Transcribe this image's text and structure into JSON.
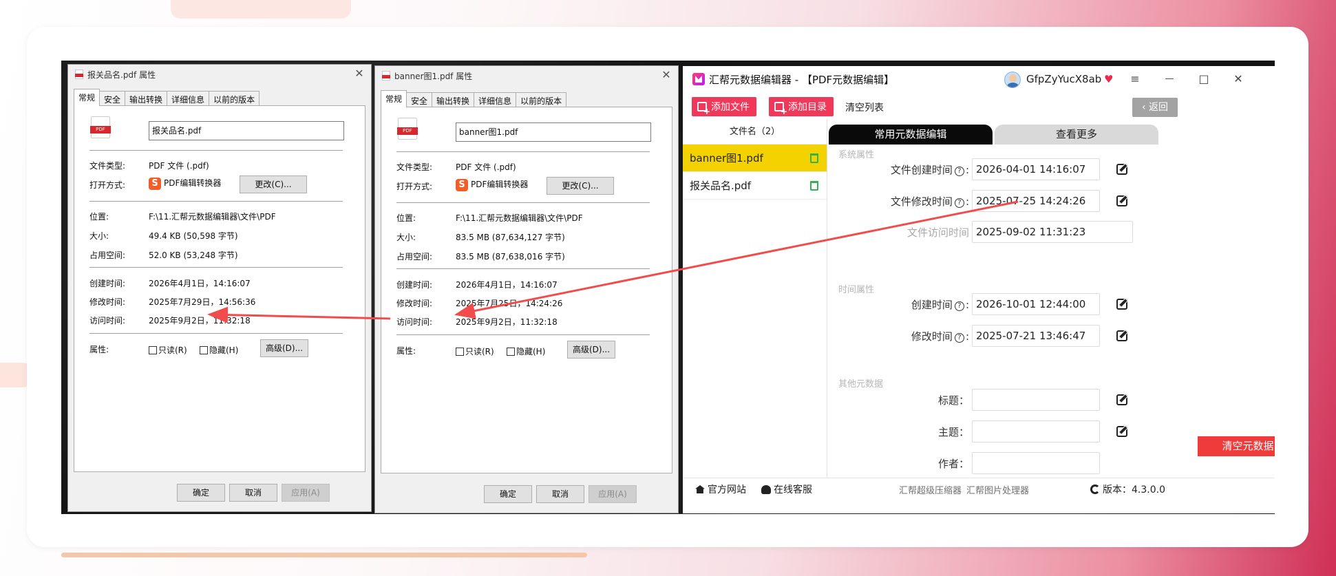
{
  "dialog_left": {
    "title": "报关品名.pdf 属性",
    "tabs": [
      "常规",
      "安全",
      "输出转换",
      "详细信息",
      "以前的版本"
    ],
    "filename": "报关品名.pdf",
    "rows": {
      "type_label": "文件类型:",
      "type_value": "PDF 文件 (.pdf)",
      "open_label": "打开方式:",
      "open_value": "PDF编辑转换器",
      "change_btn": "更改(C)...",
      "loc_label": "位置:",
      "loc_value": "F:\\11.汇帮元数据编辑器\\文件\\PDF",
      "size_label": "大小:",
      "size_value": "49.4 KB (50,598 字节)",
      "disk_label": "占用空间:",
      "disk_value": "52.0 KB (53,248 字节)",
      "created_label": "创建时间:",
      "created_value": "2026年4月1日，14:16:07",
      "modified_label": "修改时间:",
      "modified_value": "2025年7月29日，14:56:36",
      "accessed_label": "访问时间:",
      "accessed_value": "2025年9月2日，11:32:18",
      "attr_label": "属性:",
      "readonly": "只读(R)",
      "hidden": "隐藏(H)",
      "advanced_btn": "高级(D)..."
    },
    "ok": "确定",
    "cancel": "取消",
    "apply": "应用(A)"
  },
  "dialog_mid": {
    "title": "banner图1.pdf 属性",
    "tabs": [
      "常规",
      "安全",
      "输出转换",
      "详细信息",
      "以前的版本"
    ],
    "filename": "banner图1.pdf",
    "rows": {
      "type_label": "文件类型:",
      "type_value": "PDF 文件 (.pdf)",
      "open_label": "打开方式:",
      "open_value": "PDF编辑转换器",
      "change_btn": "更改(C)...",
      "loc_label": "位置:",
      "loc_value": "F:\\11.汇帮元数据编辑器\\文件\\PDF",
      "size_label": "大小:",
      "size_value": "83.5 MB (87,634,127 字节)",
      "disk_label": "占用空间:",
      "disk_value": "83.5 MB (87,638,016 字节)",
      "created_label": "创建时间:",
      "created_value": "2026年4月1日，14:16:07",
      "modified_label": "修改时间:",
      "modified_value": "2025年7月25日，14:24:26",
      "accessed_label": "访问时间:",
      "accessed_value": "2025年9月2日，11:32:18",
      "attr_label": "属性:",
      "readonly": "只读(R)",
      "hidden": "隐藏(H)",
      "advanced_btn": "高级(D)..."
    },
    "ok": "确定",
    "cancel": "取消",
    "apply": "应用(A)"
  },
  "app": {
    "title": "汇帮元数据编辑器 - 【PDF元数据编辑】",
    "user": "GfpZyYucX8ab",
    "win": {
      "menu": "≡",
      "min": "—",
      "max": "□",
      "close": "✕"
    },
    "toolbar": {
      "add_file": "添加文件",
      "add_dir": "添加目录",
      "clear_list": "清空列表",
      "back": "返回"
    },
    "sidebar": {
      "header": "文件名（2）",
      "files": [
        "banner图1.pdf",
        "报关品名.pdf"
      ]
    },
    "tabs": {
      "common": "常用元数据编辑",
      "more": "查看更多"
    },
    "system_section": "系统属性",
    "file_created_label": "文件创建时间",
    "file_created": "2026-04-01 14:16:07",
    "file_modified_label": "文件修改时间",
    "file_modified": "2025-07-25 14:24:26",
    "file_accessed_label": "文件访问时间",
    "file_accessed": "2025-09-02 11:31:23",
    "time_section": "时间属性",
    "created_label": "创建时间",
    "created": "2026-10-01 12:44:00",
    "modified_label": "修改时间",
    "modified": "2025-07-21 13:46:47",
    "other_section": "其他元数据",
    "title_label": "标题：",
    "subject_label": "主题：",
    "author_label": "作者：",
    "clear_meta": "清空元数据",
    "footer": {
      "website": "官方网站",
      "service": "在线客服",
      "compressor": "汇帮超级压缩器",
      "image_tool": "汇帮图片处理器",
      "version": "版本：4.3.0.0"
    }
  },
  "colors": {
    "accent_red": "#f0385b",
    "selected_yellow": "#f3d200",
    "arrow": "#f24b4b"
  }
}
